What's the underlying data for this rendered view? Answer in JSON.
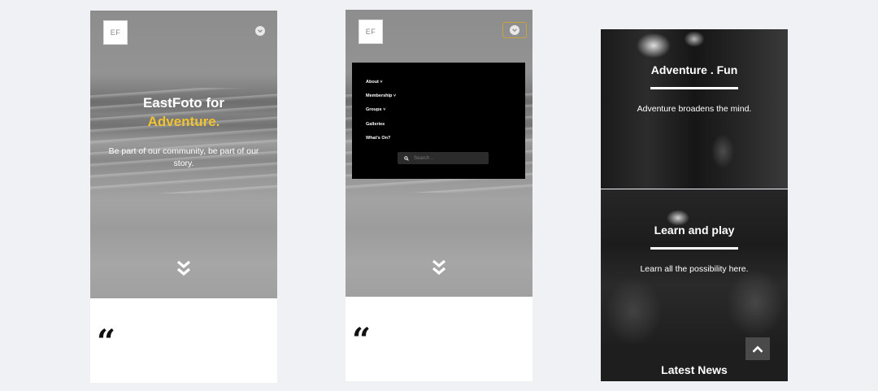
{
  "screen1": {
    "logo": "EF",
    "hero_line1": "EastFoto for",
    "hero_accent": "Adventure.",
    "hero_sub": "Be part of our community, be part of our story.",
    "quote_mark": "“"
  },
  "screen2": {
    "logo": "EF",
    "menu_items": [
      "About ˅",
      "Membership ˅",
      "Groups ˅",
      "Galleries",
      "What's On?"
    ],
    "search_placeholder": "Search ..",
    "quote_mark": "“"
  },
  "screen3": {
    "panel1_title": "Adventure . Fun",
    "panel1_sub": "Adventure broadens the mind.",
    "panel2_title": "Learn and play",
    "panel2_sub": "Learn all the possibility here.",
    "news_title": "Latest News"
  },
  "icons": {
    "menu_toggle": "chevron-down-circle-icon",
    "scroll_down": "double-chevron-down-icon",
    "search": "search-icon",
    "back_to_top": "chevron-up-icon"
  },
  "colors": {
    "accent": "#f1c232",
    "page_bg": "#f0f1f5",
    "overlay": "#000000"
  }
}
